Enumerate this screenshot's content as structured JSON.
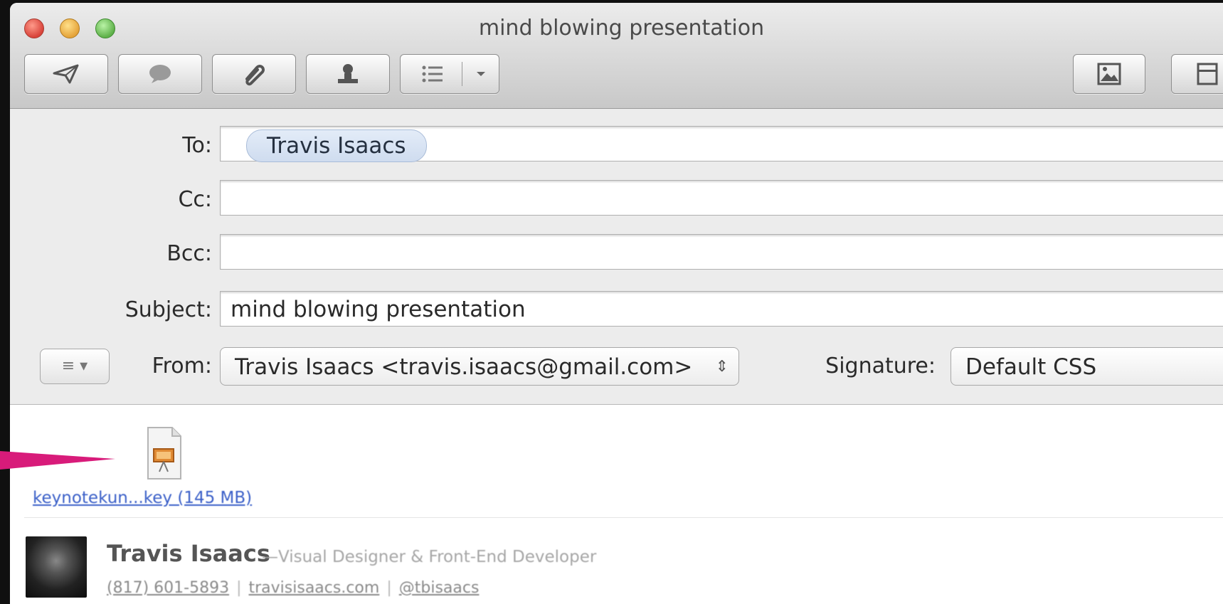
{
  "window": {
    "title": "mind blowing presentation"
  },
  "toolbar": {
    "buttons": [
      {
        "name": "send",
        "icon": "paper-plane-icon"
      },
      {
        "name": "reply",
        "icon": "speech-bubble-icon"
      },
      {
        "name": "attach",
        "icon": "paperclip-icon"
      },
      {
        "name": "address",
        "icon": "person-icon"
      },
      {
        "name": "format",
        "icon": "list-icon"
      },
      {
        "name": "photo",
        "icon": "photo-browser-icon"
      },
      {
        "name": "stationery",
        "icon": "stationery-icon"
      }
    ]
  },
  "compose": {
    "to_label": "To:",
    "to_recipient": "Travis Isaacs",
    "cc_label": "Cc:",
    "cc_value": "",
    "bcc_label": "Bcc:",
    "bcc_value": "",
    "subject_label": "Subject:",
    "subject_value": "mind blowing presentation",
    "from_label": "From:",
    "from_value": "Travis Isaacs <travis.isaacs@gmail.com>",
    "signature_label": "Signature:",
    "signature_value": "Default CSS"
  },
  "body": {
    "attachment": {
      "filename": "keynotekun...key (145 MB)",
      "icon": "keynote-file-icon"
    },
    "signature": {
      "name": "Travis Isaacs",
      "role": "—Visual Designer & Front-End Developer",
      "phone": "(817) 601-5893",
      "website": "travisisaacs.com",
      "twitter": "@tbisaacs"
    }
  },
  "colors": {
    "annotation_arrow": "#d81b7a",
    "link": "#3a5fc8"
  }
}
